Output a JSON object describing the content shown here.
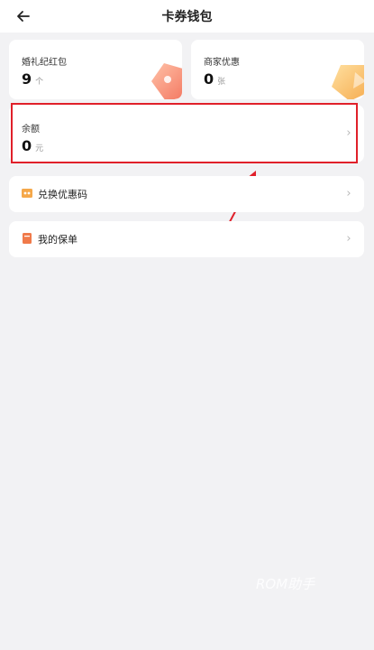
{
  "header": {
    "title": "卡券钱包",
    "back_icon": "back-arrow-icon"
  },
  "cards": {
    "wedding_redpacket": {
      "label": "婚礼纪红包",
      "value": "9",
      "unit": "个"
    },
    "merchant_discount": {
      "label": "商家优惠",
      "value": "0",
      "unit": "张"
    },
    "balance": {
      "label": "余额",
      "value": "0",
      "unit": "元"
    }
  },
  "rows": [
    {
      "label": "兑换优惠码",
      "icon": "coupon-code-icon"
    },
    {
      "label": "我的保单",
      "icon": "policy-icon"
    }
  ],
  "annotation": {
    "highlight_color": "#e0202a"
  },
  "watermark": "ROM助手",
  "colors": {
    "accent_orange": "#f29a5a",
    "accent_red": "#e0202a"
  }
}
